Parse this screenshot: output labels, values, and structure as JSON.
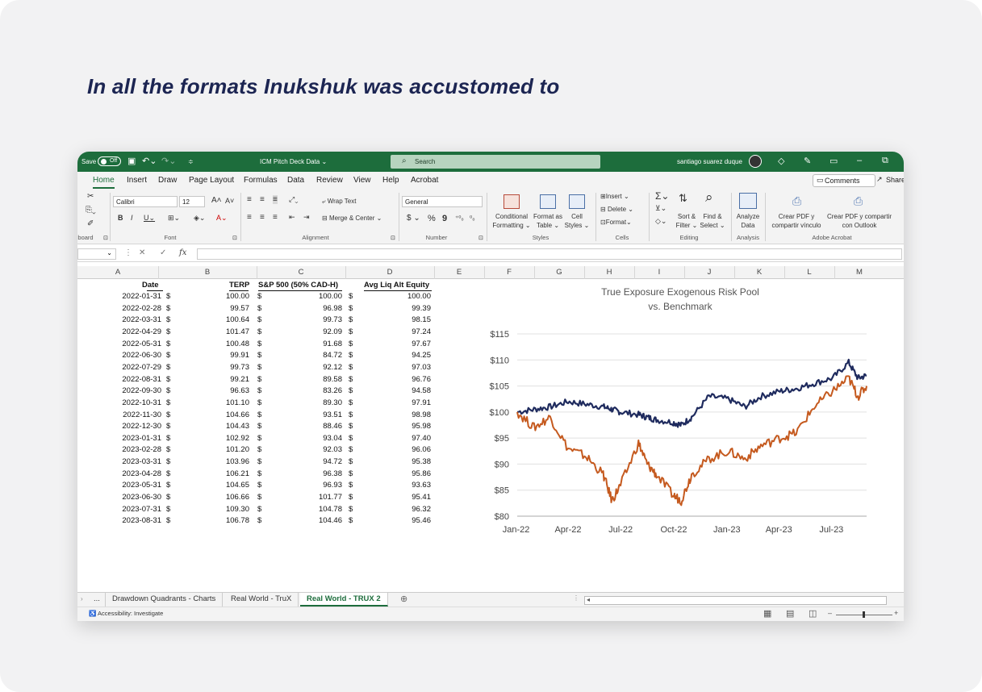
{
  "headline": "In all the formats Inukshuk was accustomed to",
  "titlebar": {
    "autosave_label": "Save",
    "autosave_state": "Off",
    "doc_name": "ICM Pitch Deck Data ⌄",
    "search_placeholder": "Search",
    "user_name": "santiago suarez duque"
  },
  "menu_tabs": [
    "Home",
    "Insert",
    "Draw",
    "Page Layout",
    "Formulas",
    "Data",
    "Review",
    "View",
    "Help",
    "Acrobat"
  ],
  "comments_label": "Comments",
  "share_label": "Share",
  "ribbon": {
    "clipboard_group": "board",
    "font_name": "Calibri",
    "font_size": "12",
    "font_group": "Font",
    "wrap_text": "Wrap Text",
    "merge_center": "Merge & Center",
    "alignment_group": "Alignment",
    "number_format": "General",
    "number_group": "Number",
    "conditional_formatting": [
      "Conditional",
      "Formatting ⌄"
    ],
    "format_as_table": [
      "Format as",
      "Table ⌄"
    ],
    "cell_styles": [
      "Cell",
      "Styles ⌄"
    ],
    "styles_group": "Styles",
    "insert": "Insert",
    "delete": "Delete",
    "format": "Format",
    "cells_group": "Cells",
    "sort_filter": [
      "Sort &",
      "Filter ⌄"
    ],
    "find_select": [
      "Find &",
      "Select ⌄"
    ],
    "editing_group": "Editing",
    "analyze_data": [
      "Analyze",
      "Data"
    ],
    "analysis_group": "Analysis",
    "pdf_link": [
      "Crear PDF y",
      "compartir vínculo"
    ],
    "pdf_outlook": [
      "Crear PDF y compartir",
      "con Outlook"
    ],
    "acrobat_group": "Adobe Acrobat"
  },
  "column_headers": [
    "A",
    "B",
    "C",
    "D",
    "E",
    "F",
    "G",
    "H",
    "I",
    "J",
    "K",
    "L",
    "M"
  ],
  "table": {
    "headers": [
      "Date",
      "TERP",
      "S&P 500 (50% CAD-H)",
      "Avg Liq Alt Equity"
    ],
    "currency": "$",
    "rows": [
      [
        "2022-01-31",
        "100.00",
        "100.00",
        "100.00"
      ],
      [
        "2022-02-28",
        "99.57",
        "96.98",
        "99.39"
      ],
      [
        "2022-03-31",
        "100.64",
        "99.73",
        "98.15"
      ],
      [
        "2022-04-29",
        "101.47",
        "92.09",
        "97.24"
      ],
      [
        "2022-05-31",
        "100.48",
        "91.68",
        "97.67"
      ],
      [
        "2022-06-30",
        "99.91",
        "84.72",
        "94.25"
      ],
      [
        "2022-07-29",
        "99.73",
        "92.12",
        "97.03"
      ],
      [
        "2022-08-31",
        "99.21",
        "89.58",
        "96.76"
      ],
      [
        "2022-09-30",
        "96.63",
        "83.26",
        "94.58"
      ],
      [
        "2022-10-31",
        "101.10",
        "89.30",
        "97.91"
      ],
      [
        "2022-11-30",
        "104.66",
        "93.51",
        "98.98"
      ],
      [
        "2022-12-30",
        "104.43",
        "88.46",
        "95.98"
      ],
      [
        "2023-01-31",
        "102.92",
        "93.04",
        "97.40"
      ],
      [
        "2023-02-28",
        "101.20",
        "92.03",
        "96.06"
      ],
      [
        "2023-03-31",
        "103.96",
        "94.72",
        "95.38"
      ],
      [
        "2023-04-28",
        "106.21",
        "96.38",
        "95.86"
      ],
      [
        "2023-05-31",
        "104.65",
        "96.93",
        "93.63"
      ],
      [
        "2023-06-30",
        "106.66",
        "101.77",
        "95.41"
      ],
      [
        "2023-07-31",
        "109.30",
        "104.78",
        "96.32"
      ],
      [
        "2023-08-31",
        "106.78",
        "104.46",
        "95.46"
      ]
    ]
  },
  "chart_data": {
    "type": "line",
    "title": "True Exposure Exogenous Risk Pool",
    "subtitle": "vs. Benchmark",
    "y_ticks": [
      "$115",
      "$110",
      "$105",
      "$100",
      "$95",
      "$90",
      "$85",
      "$80"
    ],
    "ylim": [
      80,
      115
    ],
    "x_ticks": [
      "Jan-22",
      "Apr-22",
      "Jul-22",
      "Oct-22",
      "Jan-23",
      "Apr-23",
      "Jul-23"
    ],
    "x": [
      "2022-01-03",
      "2022-02-01",
      "2022-03-01",
      "2022-04-01",
      "2022-05-02",
      "2022-06-01",
      "2022-06-16",
      "2022-07-01",
      "2022-08-01",
      "2022-08-16",
      "2022-09-01",
      "2022-09-30",
      "2022-10-14",
      "2022-11-01",
      "2022-12-01",
      "2023-01-03",
      "2023-02-01",
      "2023-03-01",
      "2023-04-03",
      "2023-05-01",
      "2023-06-01",
      "2023-07-03",
      "2023-07-31",
      "2023-08-16",
      "2023-08-31"
    ],
    "series": [
      {
        "color": "#1f2b5e",
        "values": [
          100,
          100.5,
          101,
          102,
          101.5,
          101,
          100.5,
          100,
          99.5,
          99,
          98.5,
          98,
          97.5,
          99,
          103,
          102.5,
          101,
          103,
          104,
          104.5,
          105.5,
          106.5,
          109.5,
          106.5,
          107
        ]
      },
      {
        "color": "#c55a1f",
        "values": [
          100,
          97,
          99,
          93,
          91.5,
          88,
          83,
          86,
          94,
          90,
          88,
          84,
          83,
          88,
          91,
          92.5,
          91,
          93.5,
          95,
          96,
          101,
          104,
          106.5,
          103,
          105
        ]
      }
    ]
  },
  "sheet_tabs": [
    "...",
    "Drawdown Quadrants - Charts",
    "Real World - TruX",
    "Real World - TRUX 2"
  ],
  "status": {
    "accessibility": "Accessibility: Investigate"
  }
}
